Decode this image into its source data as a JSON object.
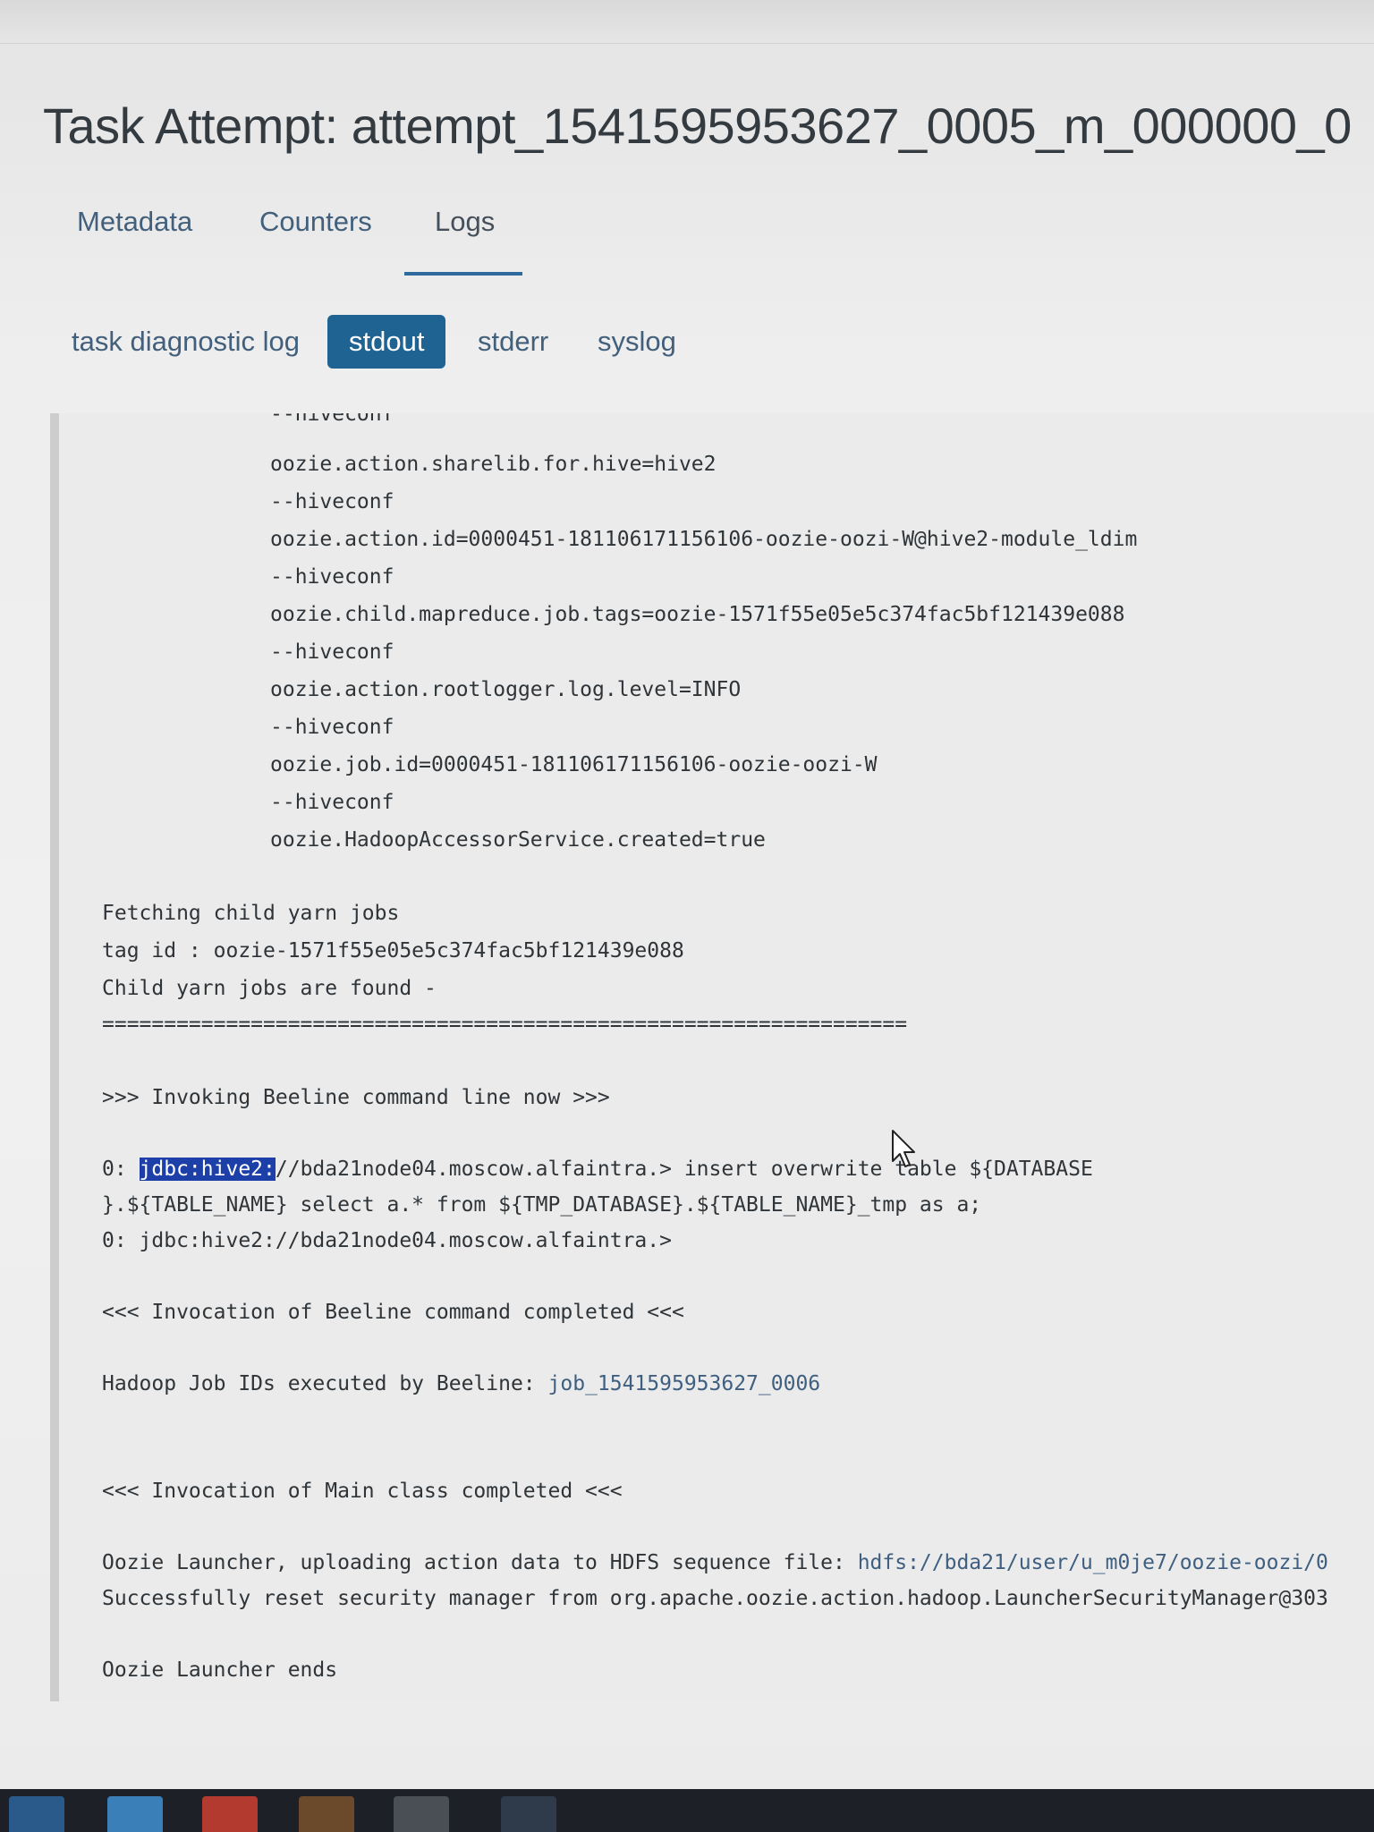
{
  "page": {
    "title": "Task Attempt: attempt_1541595953627_0005_m_000000_0"
  },
  "tabs": [
    {
      "label": "Metadata",
      "active": false
    },
    {
      "label": "Counters",
      "active": false
    },
    {
      "label": "Logs",
      "active": true
    }
  ],
  "log_tabs": [
    {
      "label": "task diagnostic log",
      "active": false
    },
    {
      "label": "stdout",
      "active": true
    },
    {
      "label": "stderr",
      "active": false
    },
    {
      "label": "syslog",
      "active": false
    }
  ],
  "log": {
    "lines": [
      "--hiveconf",
      "oozie.action.sharelib.for.hive=hive2",
      "--hiveconf",
      "oozie.action.id=0000451-181106171156106-oozie-oozi-W@hive2-module_ldim",
      "--hiveconf",
      "oozie.child.mapreduce.job.tags=oozie-1571f55e05e5c374fac5bf121439e088",
      "--hiveconf",
      "oozie.action.rootlogger.log.level=INFO",
      "--hiveconf",
      "oozie.job.id=0000451-181106171156106-oozie-oozi-W",
      "--hiveconf",
      "oozie.HadoopAccessorService.created=true",
      "Fetching child yarn jobs",
      "tag id : oozie-1571f55e05e5c374fac5bf121439e088",
      "Child yarn jobs are found -",
      "=================================================================",
      ">>> Invoking Beeline command line now >>>",
      "0: ",
      "jdbc:hive2:",
      "//bda21node04.moscow.alfaintra.> insert overwrite table ${DATABASE",
      "}.${TABLE_NAME} select a.* from ${TMP_DATABASE}.${TABLE_NAME}_tmp as a;",
      "0: jdbc:hive2://bda21node04.moscow.alfaintra.>",
      "<<< Invocation of Beeline command completed <<<",
      "Hadoop Job IDs executed by Beeline: ",
      "job_1541595953627_0006",
      "<<< Invocation of Main class completed <<<",
      "Oozie Launcher, uploading action data to HDFS sequence file: ",
      "hdfs://bda21/user/u_m0je7/oozie-oozi/0",
      "Successfully reset security manager from org.apache.oozie.action.hadoop.LauncherSecurityManager@303",
      "Oozie Launcher ends"
    ]
  },
  "colors": {
    "accent": "#1f6393",
    "selection": "#1c3fa8",
    "tab_underline": "#2e6a9e"
  },
  "icons": [
    "mouse-pointer-icon"
  ]
}
